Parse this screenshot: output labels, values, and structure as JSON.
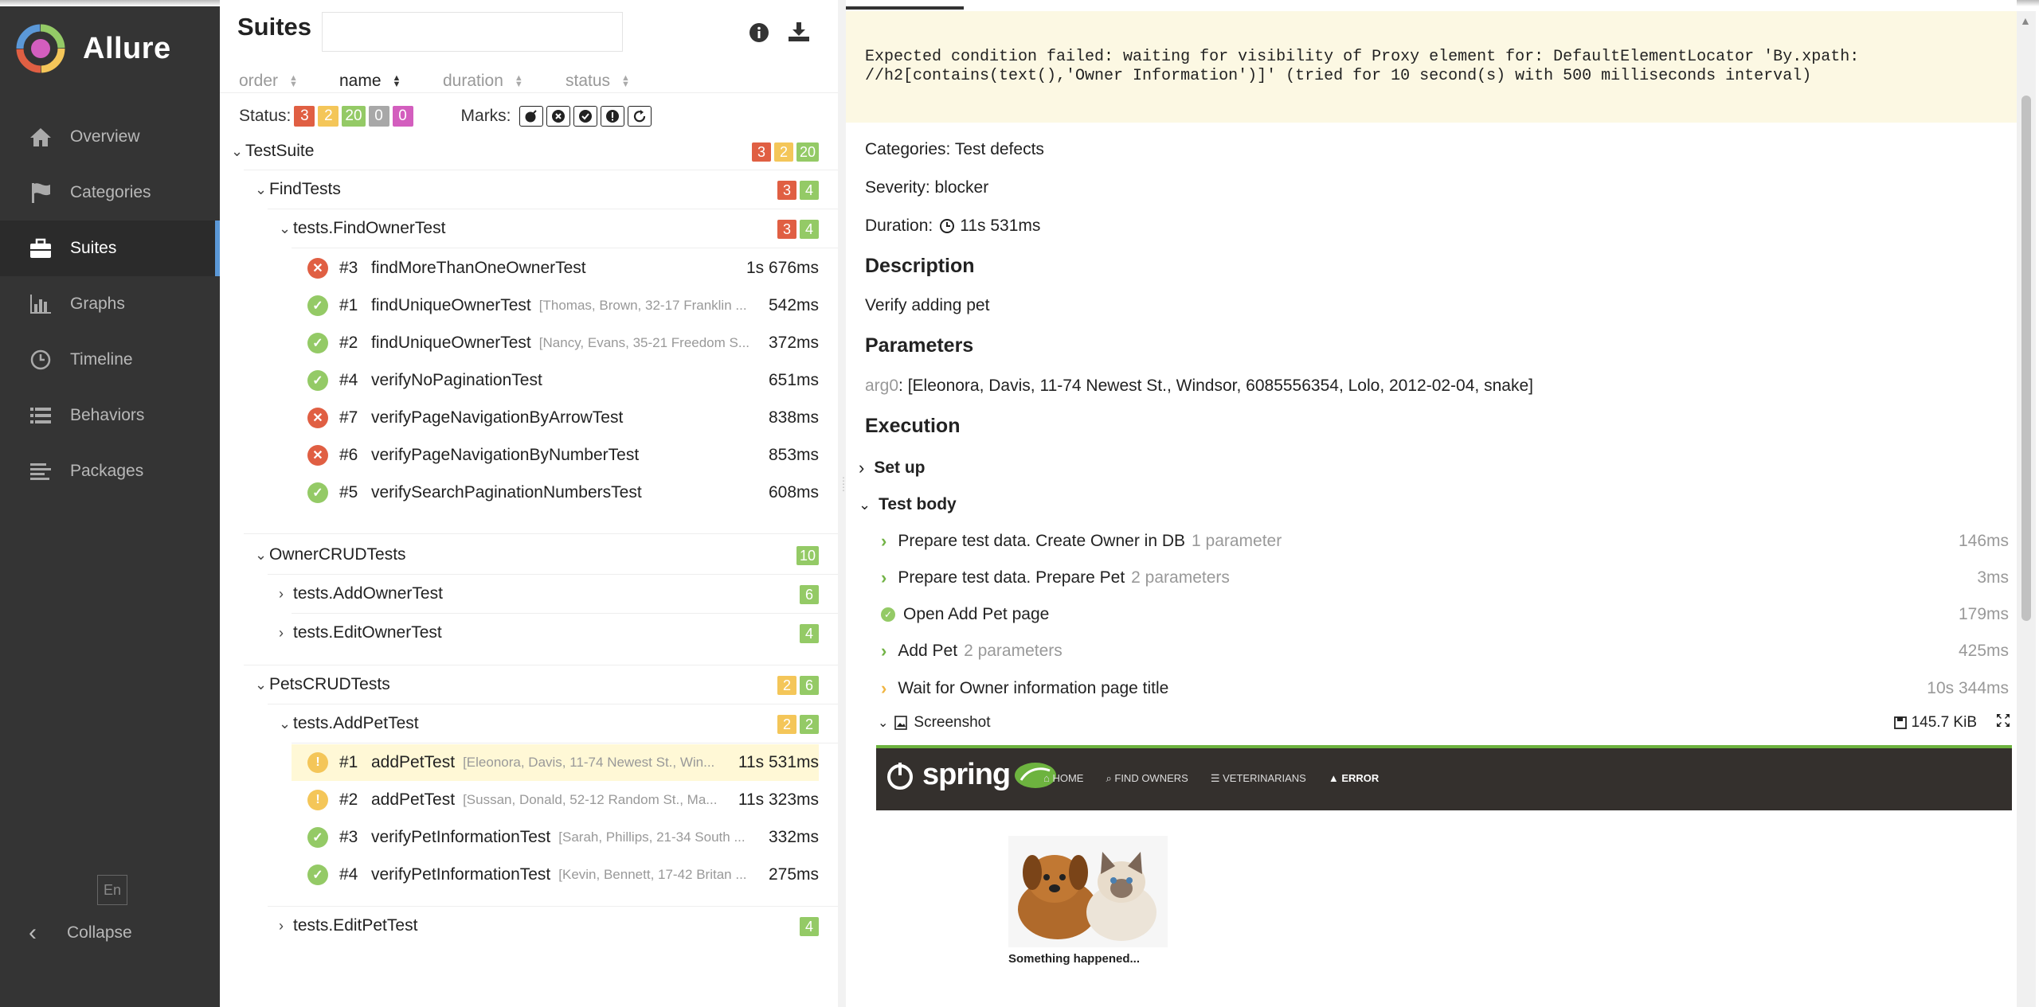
{
  "sidebar": {
    "brand": "Allure",
    "items": [
      {
        "label": "Overview",
        "icon": "home-icon"
      },
      {
        "label": "Categories",
        "icon": "flag-icon"
      },
      {
        "label": "Suites",
        "icon": "briefcase-icon"
      },
      {
        "label": "Graphs",
        "icon": "bar-chart-icon"
      },
      {
        "label": "Timeline",
        "icon": "clock-icon"
      },
      {
        "label": "Behaviors",
        "icon": "list-icon"
      },
      {
        "label": "Packages",
        "icon": "align-left-icon"
      }
    ],
    "active": "Suites",
    "language": "En",
    "collapse": "Collapse"
  },
  "tree": {
    "title": "Suites",
    "search_value": "",
    "sort": {
      "order": "order",
      "name": "name",
      "duration": "duration",
      "status": "status"
    },
    "status_label": "Status:",
    "status_counts": [
      "3",
      "2",
      "20",
      "0",
      "0"
    ],
    "marks_label": "Marks:",
    "suites": [
      {
        "name": "TestSuite",
        "counts": [
          "3",
          "2",
          "20"
        ]
      },
      {
        "name": "FindTests",
        "counts": [
          "3",
          "4"
        ]
      },
      {
        "name": "tests.FindOwnerTest",
        "counts": [
          "3",
          "4"
        ]
      },
      {
        "name": "OwnerCRUDTests",
        "counts": [
          "10"
        ]
      },
      {
        "name": "tests.AddOwnerTest",
        "counts": [
          "6"
        ]
      },
      {
        "name": "tests.EditOwnerTest",
        "counts": [
          "4"
        ]
      },
      {
        "name": "PetsCRUDTests",
        "counts": [
          "2",
          "6"
        ]
      },
      {
        "name": "tests.AddPetTest",
        "counts": [
          "2",
          "2"
        ]
      },
      {
        "name": "tests.EditPetTest",
        "counts": [
          "4"
        ]
      }
    ],
    "cases": [
      {
        "num": "#3",
        "name": "findMoreThanOneOwnerTest",
        "params": "",
        "dur": "1s 676ms",
        "status": "failed"
      },
      {
        "num": "#1",
        "name": "findUniqueOwnerTest",
        "params": "[Thomas, Brown, 32-17 Franklin ...",
        "dur": "542ms",
        "status": "passed"
      },
      {
        "num": "#2",
        "name": "findUniqueOwnerTest",
        "params": "[Nancy, Evans, 35-21 Freedom S...",
        "dur": "372ms",
        "status": "passed"
      },
      {
        "num": "#4",
        "name": "verifyNoPaginationTest",
        "params": "",
        "dur": "651ms",
        "status": "passed"
      },
      {
        "num": "#7",
        "name": "verifyPageNavigationByArrowTest",
        "params": "",
        "dur": "838ms",
        "status": "failed"
      },
      {
        "num": "#6",
        "name": "verifyPageNavigationByNumberTest",
        "params": "",
        "dur": "853ms",
        "status": "failed"
      },
      {
        "num": "#5",
        "name": "verifySearchPaginationNumbersTest",
        "params": "",
        "dur": "608ms",
        "status": "passed"
      },
      {
        "num": "#1",
        "name": "addPetTest",
        "params": "[Eleonora, Davis, 11-74 Newest St., Win...",
        "dur": "11s 531ms",
        "status": "broken"
      },
      {
        "num": "#2",
        "name": "addPetTest",
        "params": "[Sussan, Donald, 52-12 Random St., Ma...",
        "dur": "11s 323ms",
        "status": "broken"
      },
      {
        "num": "#3",
        "name": "verifyPetInformationTest",
        "params": "[Sarah, Phillips, 21-34 South ...",
        "dur": "332ms",
        "status": "passed"
      },
      {
        "num": "#4",
        "name": "verifyPetInformationTest",
        "params": "[Kevin, Bennett, 17-42 Britan ...",
        "dur": "275ms",
        "status": "passed"
      }
    ]
  },
  "detail": {
    "error_message": "Expected condition failed: waiting for visibility of Proxy element for: DefaultElementLocator 'By.xpath:\n//h2[contains(text(),'Owner Information')]' (tried for 10 second(s) with 500 milliseconds interval)",
    "categories": "Categories: Test defects",
    "severity": "Severity: blocker",
    "duration_label": "Duration:",
    "duration": "11s 531ms",
    "description_heading": "Description",
    "description": "Verify adding pet",
    "parameters_heading": "Parameters",
    "param_key": "arg0",
    "param_value": ": [Eleonora, Davis, 11-74 Newest St., Windsor, 6085556354, Lolo, 2012-02-04, snake]",
    "execution_heading": "Execution",
    "setup": "Set up",
    "test_body": "Test body",
    "steps": [
      {
        "name": "Prepare test data. Create Owner in DB",
        "extra": "1 parameter",
        "time": "146ms"
      },
      {
        "name": "Prepare test data. Prepare Pet",
        "extra": "2 parameters",
        "time": "3ms"
      },
      {
        "name": "Open Add Pet page",
        "extra": "",
        "time": "179ms"
      },
      {
        "name": "Add Pet",
        "extra": "2 parameters",
        "time": "425ms"
      },
      {
        "name": "Wait for Owner information page title",
        "extra": "",
        "time": "10s 344ms"
      }
    ],
    "attachment": {
      "name": "Screenshot",
      "size": "145.7 KiB"
    },
    "screenshot": {
      "logo": "spring",
      "menu": [
        "HOME",
        "FIND OWNERS",
        "VETERINARIANS",
        "ERROR"
      ],
      "caption": "Something happened..."
    }
  }
}
